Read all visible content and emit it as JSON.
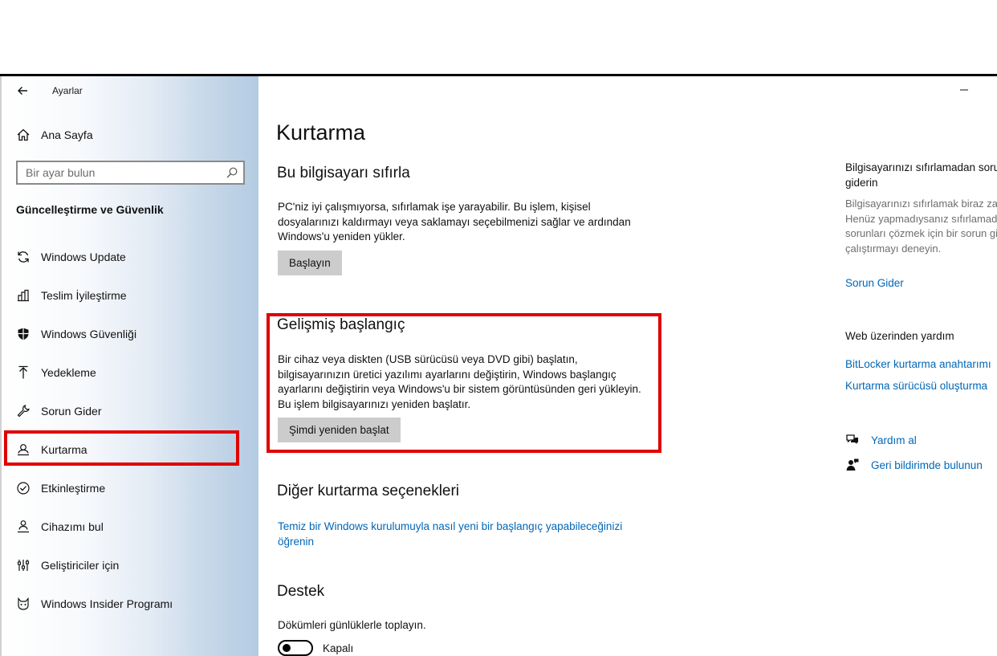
{
  "window": {
    "title": "Ayarlar"
  },
  "sidebar": {
    "home_label": "Ana Sayfa",
    "search_placeholder": "Bir ayar bulun",
    "section_title": "Güncelleştirme ve Güvenlik",
    "items": [
      {
        "label": "Windows Update",
        "icon": "sync-icon"
      },
      {
        "label": "Teslim İyileştirme",
        "icon": "delivery-optimization-icon"
      },
      {
        "label": "Windows Güvenliği",
        "icon": "shield-icon"
      },
      {
        "label": "Yedekleme",
        "icon": "backup-arrow-icon"
      },
      {
        "label": "Sorun Gider",
        "icon": "wrench-icon"
      },
      {
        "label": "Kurtarma",
        "icon": "recovery-icon",
        "selected": true
      },
      {
        "label": "Etkinleştirme",
        "icon": "check-circle-icon"
      },
      {
        "label": "Cihazımı bul",
        "icon": "person-location-icon"
      },
      {
        "label": "Geliştiriciler için",
        "icon": "developer-icon"
      },
      {
        "label": "Windows Insider Programı",
        "icon": "insider-cat-icon"
      }
    ]
  },
  "main": {
    "page_title": "Kurtarma",
    "reset": {
      "title": "Bu bilgisayarı sıfırla",
      "text": "PC'niz iyi çalışmıyorsa, sıfırlamak işe yarayabilir. Bu işlem, kişisel dosyalarınızı kaldırmayı veya saklamayı seçebilmenizi sağlar ve ardından Windows'u yeniden yükler.",
      "button": "Başlayın"
    },
    "advanced": {
      "title": "Gelişmiş başlangıç",
      "text": "Bir cihaz veya diskten (USB sürücüsü veya DVD gibi) başlatın, bilgisayarınızın üretici yazılımı ayarlarını değiştirin, Windows başlangıç ayarlarını değiştirin veya Windows'u bir sistem görüntüsünden geri yükleyin. Bu işlem bilgisayarınızı yeniden başlatır.",
      "button": "Şimdi yeniden başlat"
    },
    "other": {
      "title": "Diğer kurtarma seçenekleri",
      "link": "Temiz bir Windows kurulumuyla nasıl yeni bir başlangıç yapabileceğinizi öğrenin"
    },
    "support": {
      "title": "Destek",
      "text": "Dökümleri günlüklerle toplayın.",
      "toggle_label": "Kapalı",
      "toggle_on": false
    }
  },
  "right": {
    "tip_title": "Bilgisayarınızı sıfırlamadan sorunları giderin",
    "tip_text": "Bilgisayarınızı sıfırlamak biraz zaman alabilir. Henüz yapmadıysanız sıfırlamadan önce sorunları çözmek için bir sorun giderici çalıştırmayı deneyin.",
    "tip_link": "Sorun Gider",
    "web_help_title": "Web üzerinden yardım",
    "web_links": [
      "BitLocker kurtarma anahtarımı",
      "Kurtarma sürücüsü oluşturma"
    ],
    "help_label": "Yardım al",
    "feedback_label": "Geri bildirimde bulunun"
  },
  "colors": {
    "accent": "#0067b8",
    "highlight": "#e00000",
    "button": "#cccccc"
  }
}
